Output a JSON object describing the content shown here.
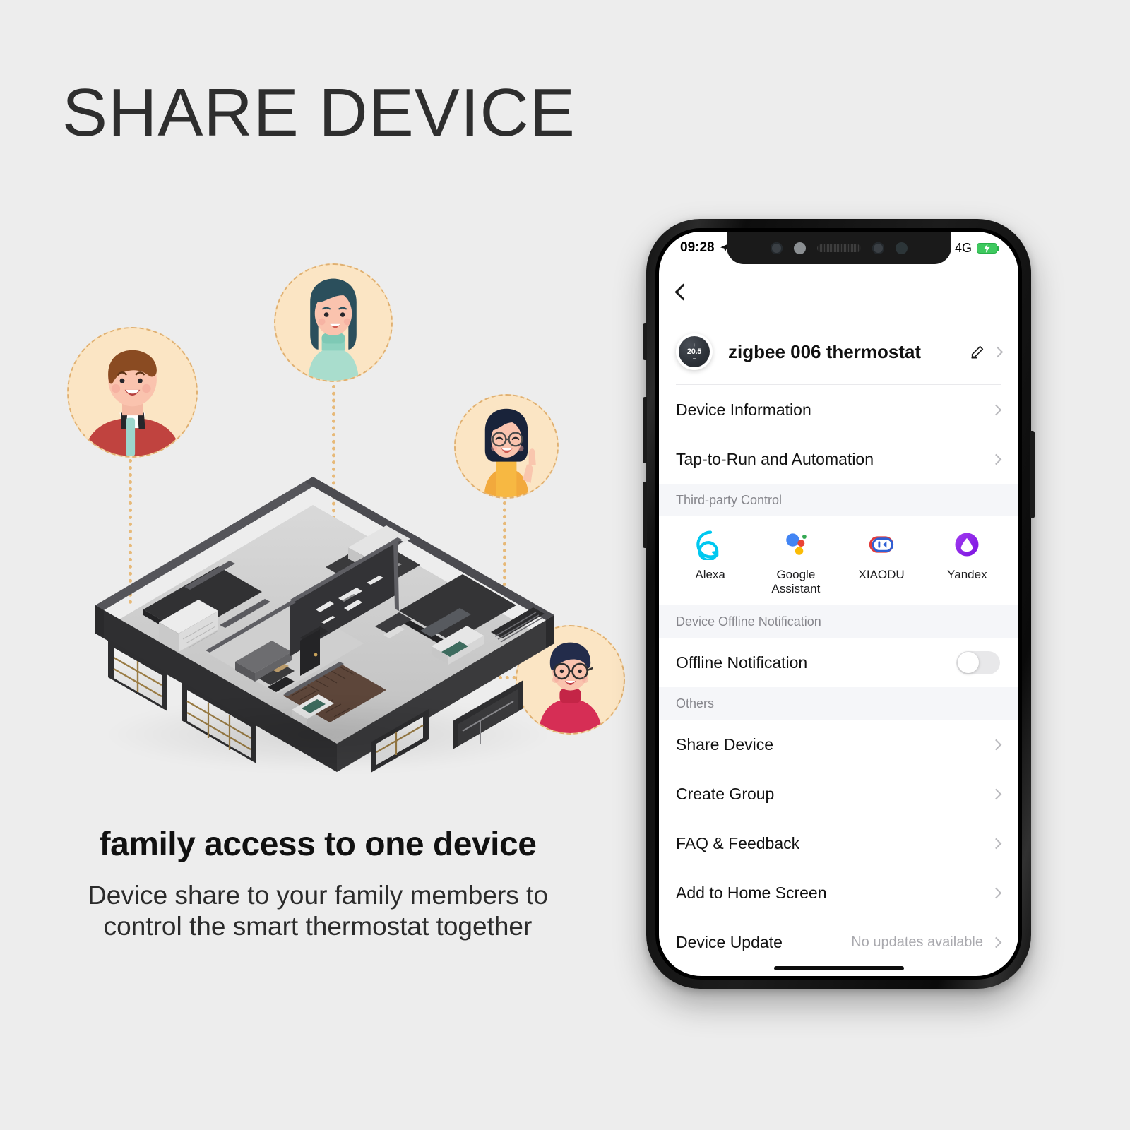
{
  "headline": "SHARE DEVICE",
  "caption": {
    "main": "family access to one device",
    "sub_line1": "Device share to your family members to",
    "sub_line2": "control the smart thermostat together"
  },
  "colors": {
    "background": "#ededed",
    "accent_dotted": "#e7b978",
    "avatar_bg": "#fbe3bd",
    "section_bg": "#f5f6f9",
    "battery_green": "#3ec95f"
  },
  "phone": {
    "status_bar": {
      "time": "09:28",
      "location_icon": "location-arrow-icon",
      "signal_icon": "signal-bars-icon",
      "network": "4G",
      "battery_icon": "battery-charging-icon"
    },
    "nav": {
      "back_icon": "chevron-left-icon"
    },
    "device_header": {
      "thumbnail_icon": "thermostat-dial-icon",
      "thumbnail_temp": "20.5",
      "thumbnail_plus": "+",
      "thumbnail_minus": "−",
      "name": "zigbee 006 thermostat",
      "edit_icon": "pencil-icon",
      "chevron_icon": "chevron-right-icon"
    },
    "top_rows": [
      {
        "label": "Device Information",
        "chevron": "chevron-right-icon"
      },
      {
        "label": "Tap-to-Run and Automation",
        "chevron": "chevron-right-icon"
      }
    ],
    "third_party": {
      "section_title": "Third-party Control",
      "items": [
        {
          "label": "Alexa",
          "icon": "alexa-icon",
          "color": "#00c8f0"
        },
        {
          "label": "Google\nAssistant",
          "label_line1": "Google",
          "label_line2": "Assistant",
          "icon": "google-assistant-icon",
          "color": "#4285f4"
        },
        {
          "label": "XIAODU",
          "icon": "xiaodu-icon",
          "color": "#e23b3b"
        },
        {
          "label": "Yandex",
          "icon": "yandex-alice-icon",
          "color": "#8e2fe8"
        }
      ]
    },
    "offline": {
      "section_title": "Device Offline Notification",
      "row_label": "Offline Notification",
      "toggle_state": "off"
    },
    "others": {
      "section_title": "Others",
      "rows": [
        {
          "label": "Share Device",
          "value": "",
          "chevron": "chevron-right-icon"
        },
        {
          "label": "Create Group",
          "value": "",
          "chevron": "chevron-right-icon"
        },
        {
          "label": "FAQ & Feedback",
          "value": "",
          "chevron": "chevron-right-icon"
        },
        {
          "label": "Add to Home Screen",
          "value": "",
          "chevron": "chevron-right-icon"
        },
        {
          "label": "Device Update",
          "value": "No updates available",
          "chevron": "chevron-right-icon"
        }
      ]
    }
  },
  "illustration": {
    "house_label": "isometric-house-floorplan",
    "avatars": [
      {
        "name": "avatar-man-red-jacket"
      },
      {
        "name": "avatar-woman-long-hair"
      },
      {
        "name": "avatar-woman-glasses-waving"
      },
      {
        "name": "avatar-man-glasses-red-turtleneck"
      }
    ]
  }
}
